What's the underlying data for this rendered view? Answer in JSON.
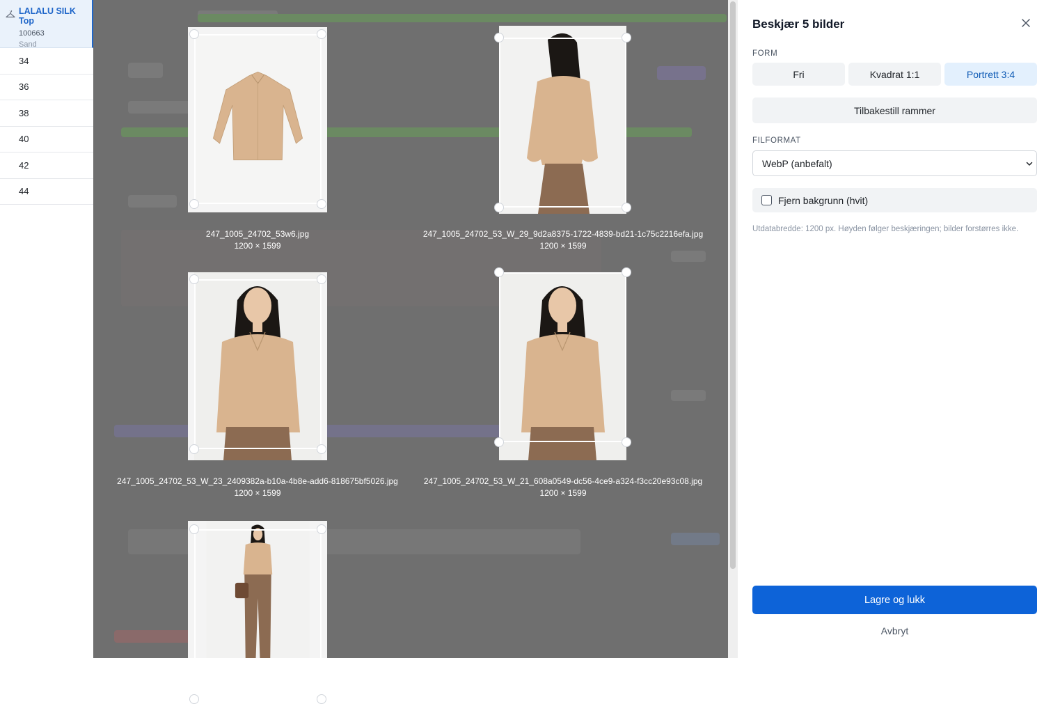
{
  "sidebar": {
    "product": {
      "title": "LALALU SILK Top",
      "sku": "100663",
      "color": "Sand"
    },
    "sizes": [
      "34",
      "36",
      "38",
      "40",
      "42",
      "44"
    ]
  },
  "images": [
    {
      "filename": "247_1005_24702_53w6.jpg",
      "dims": "1200 × 1599",
      "kind": "flatlay"
    },
    {
      "filename": "247_1005_24702_53_W_29_9d2a8375-1722-4839-bd21-1c75c2216efa.jpg",
      "dims": "1200 × 1599",
      "kind": "back"
    },
    {
      "filename": "247_1005_24702_53_W_23_2409382a-b10a-4b8e-add6-818675bf5026.jpg",
      "dims": "1200 × 1599",
      "kind": "portrait"
    },
    {
      "filename": "247_1005_24702_53_W_21_608a0549-dc56-4ce9-a324-f3cc20e93c08.jpg",
      "dims": "1200 × 1599",
      "kind": "front"
    },
    {
      "filename": "",
      "dims": "",
      "kind": "full"
    }
  ],
  "panel": {
    "title": "Beskjær 5 bilder",
    "form_label": "FORM",
    "form_options": [
      "Fri",
      "Kvadrat 1:1",
      "Portrett 3:4"
    ],
    "selected_form": "Portrett 3:4",
    "reset_label": "Tilbakestill rammer",
    "format_label": "FILFORMAT",
    "format_value": "WebP (anbefalt)",
    "remove_bg_label": "Fjern bakgrunn (hvit)",
    "remove_bg_checked": false,
    "hint": "Utdatabredde: 1200 px. Høyden følger beskjæringen; bilder forstørres ikke.",
    "save_label": "Lagre og lukk",
    "cancel_label": "Avbryt"
  },
  "colors": {
    "accent": "#0d63d8",
    "active_segment_bg": "#e3f0fd",
    "sidebar_accent": "#1f66c9",
    "shirt": "#d9b48f",
    "trousers": "#8c6b52",
    "hair": "#1b1714"
  }
}
